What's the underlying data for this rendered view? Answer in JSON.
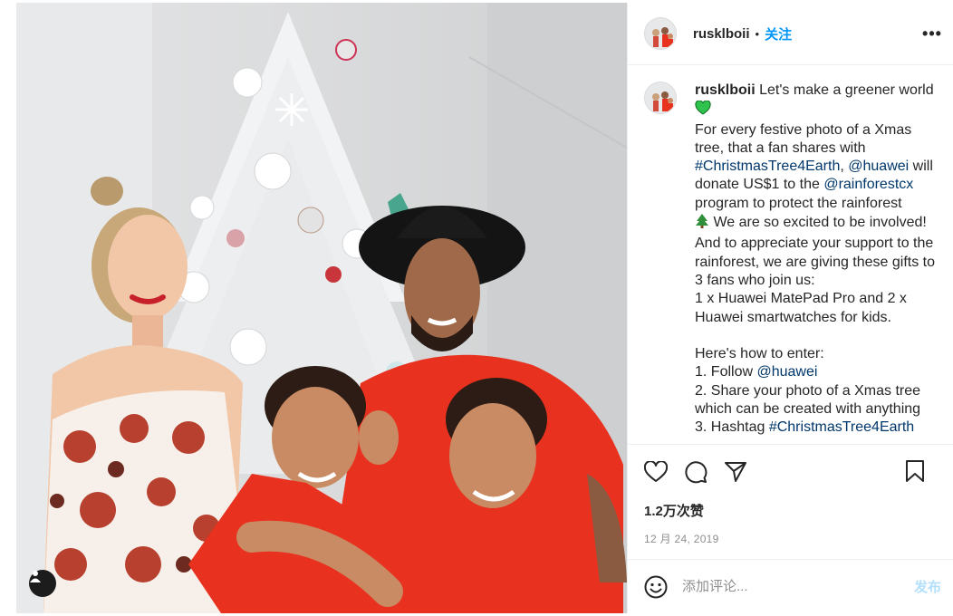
{
  "post": {
    "username": "rusklboii",
    "dot": "•",
    "follow_label": "关注",
    "more_label": "•••",
    "caption_user": "rusklboii",
    "caption": [
      {
        "t": "text",
        "v": " Let's make a greener world "
      },
      {
        "t": "emoji",
        "v": "green-heart-icon"
      },
      {
        "t": "text",
        "v": "\nFor every festive photo of a Xmas tree, that a fan shares with "
      },
      {
        "t": "tag",
        "v": "#ChristmasTree4Earth"
      },
      {
        "t": "text",
        "v": ", "
      },
      {
        "t": "tag",
        "v": "@huawei"
      },
      {
        "t": "text",
        "v": " will donate US$1 to the "
      },
      {
        "t": "tag",
        "v": "@rainforestcx"
      },
      {
        "t": "text",
        "v": " program to protect the rainforest\n"
      },
      {
        "t": "emoji",
        "v": "christmas-tree-icon"
      },
      {
        "t": "text",
        "v": " We are so excited to be involved!\nAnd to appreciate your support to the rainforest, we are giving these gifts to 3 fans who join us:\n1 x Huawei MatePad Pro and 2 x Huawei smartwatches for kids.\n\nHere's how to enter:\n1. Follow "
      },
      {
        "t": "tag",
        "v": "@huawei"
      },
      {
        "t": "text",
        "v": "\n2. Share your photo of a Xmas tree which can be created with anything\n3. Hashtag "
      },
      {
        "t": "tag",
        "v": "#ChristmasTree4Earth"
      }
    ],
    "likes": "1.2万次赞",
    "date": "12 月 24, 2019",
    "comment_placeholder": "添加评论...",
    "post_label": "发布"
  },
  "icons": {
    "like": "heart-icon",
    "comment": "comment-icon",
    "share": "share-icon",
    "save": "bookmark-icon",
    "emoji": "smiley-icon",
    "user_tag": "person-icon"
  },
  "colors": {
    "accent": "#0095f6",
    "hashtag": "#00376b",
    "post_disabled": "#b2dffc",
    "muted": "#8e8e8e"
  }
}
